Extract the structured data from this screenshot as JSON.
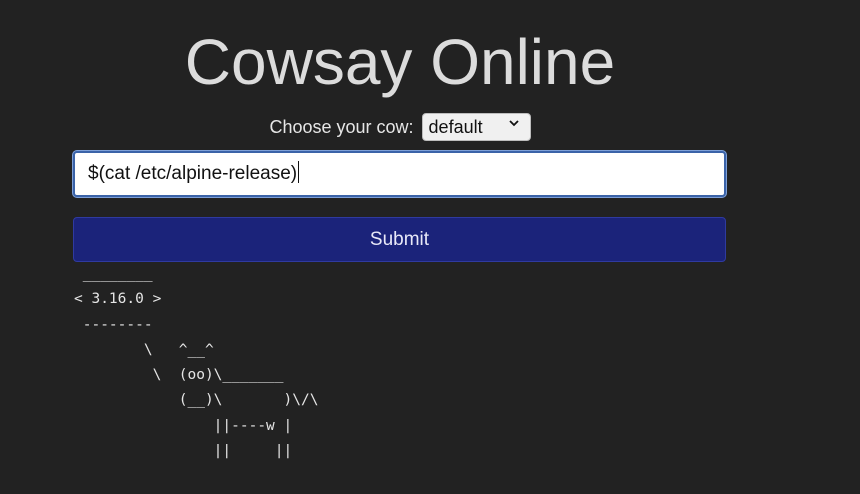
{
  "title": "Cowsay Online",
  "cow_chooser": {
    "label": "Choose your cow:",
    "selected": "default",
    "icon": "chevron-down-icon"
  },
  "message_input": {
    "value": "$(cat /etc/alpine-release)"
  },
  "submit_label": "Submit",
  "output": " ________\n< 3.16.0 >\n --------\n        \\   ^__^\n         \\  (oo)\\_______\n            (__)\\       )\\/\\\n                ||----w |\n                ||     ||",
  "colors": {
    "background": "#222222",
    "button": "#1b237a",
    "input_focus_border": "#3b63a8"
  }
}
